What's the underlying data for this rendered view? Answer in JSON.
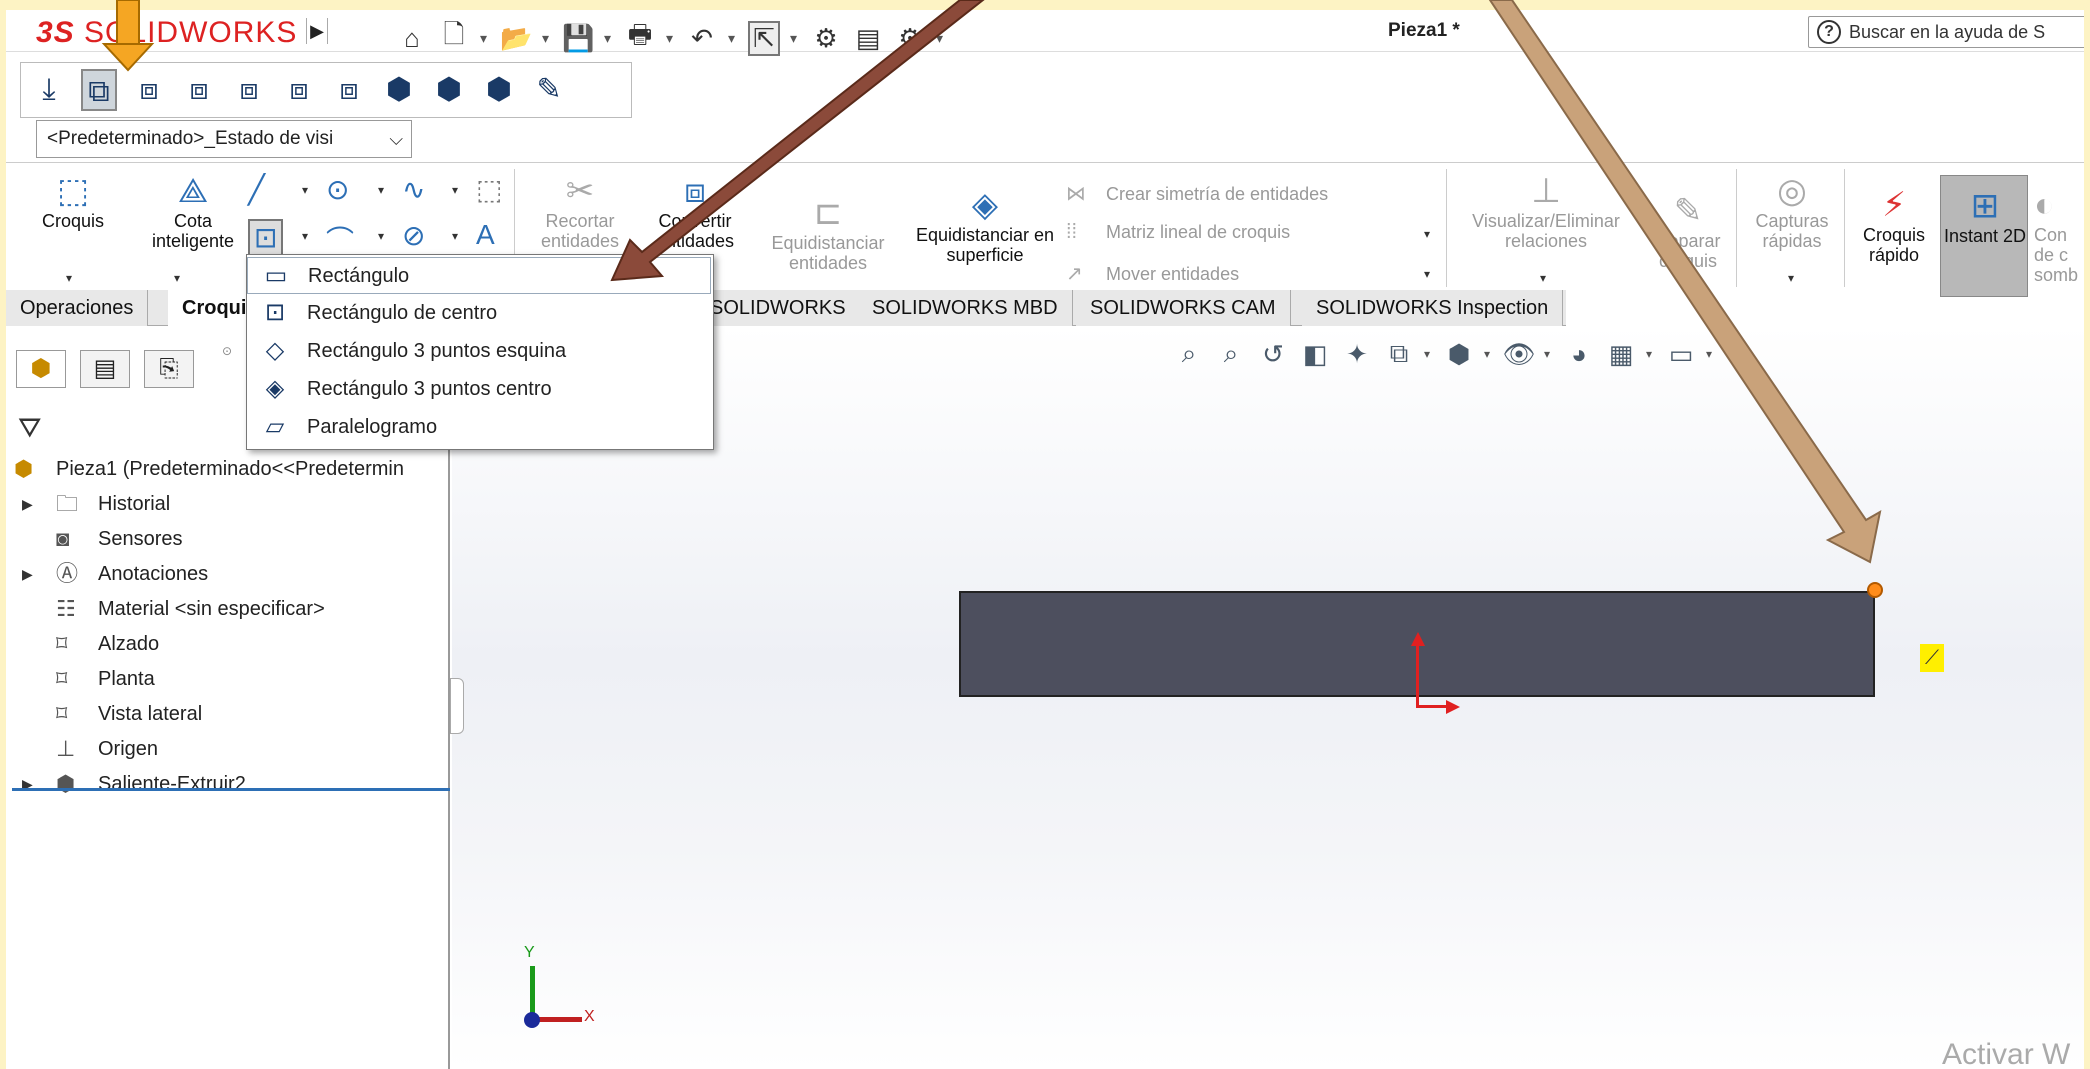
{
  "app": {
    "brand_prefix": "3S",
    "brand_suffix": "SOLIDWORKS",
    "doc_title": "Pieza1 *",
    "search_placeholder": "Buscar en la ayuda de S"
  },
  "config": {
    "selected": "<Predeterminado>_Estado de visi"
  },
  "commands": {
    "croquis": "Croquis",
    "cota": "Cota inteligente",
    "recortar": "Recortar entidades",
    "convertir": "Convertir entidades",
    "equidistanciar": "Equidistanciar entidades",
    "equid_superficie": "Equidistanciar en superficie",
    "simetria": "Crear simetría de entidades",
    "matriz": "Matriz lineal de croquis",
    "mover": "Mover entidades",
    "visualizar": "Visualizar/Eliminar relaciones",
    "reparar": "Reparar croquis",
    "capturas": "Capturas rápidas",
    "croquis_rapido": "Croquis rápido",
    "instant2d": "Instant 2D",
    "con": "Con de c somb"
  },
  "tabs": [
    "Operaciones",
    "Croquis",
    "SOLIDWORKS",
    "SOLIDWORKS MBD",
    "SOLIDWORKS CAM",
    "SOLIDWORKS Inspection"
  ],
  "rect_menu": [
    {
      "label": "Rectángulo",
      "icon": "rectangle-corner-icon"
    },
    {
      "label": "Rectángulo de centro",
      "icon": "rectangle-center-icon"
    },
    {
      "label": "Rectángulo 3 puntos esquina",
      "icon": "rectangle-3pt-corner-icon"
    },
    {
      "label": "Rectángulo 3 puntos centro",
      "icon": "rectangle-3pt-center-icon"
    },
    {
      "label": "Paralelogramo",
      "icon": "parallelogram-icon"
    }
  ],
  "tree": {
    "root": "Pieza1  (Predeterminado<<Predetermin",
    "items": [
      {
        "label": "Historial",
        "icon": "history-folder-icon"
      },
      {
        "label": "Sensores",
        "icon": "sensor-icon"
      },
      {
        "label": "Anotaciones",
        "icon": "annotations-icon"
      },
      {
        "label": "Material <sin especificar>",
        "icon": "material-icon"
      },
      {
        "label": "Alzado",
        "icon": "plane-icon"
      },
      {
        "label": "Planta",
        "icon": "plane-icon"
      },
      {
        "label": "Vista lateral",
        "icon": "plane-icon"
      },
      {
        "label": "Origen",
        "icon": "origin-icon"
      },
      {
        "label": "Saliente-Extruir2",
        "icon": "extrude-icon"
      }
    ]
  },
  "triad": {
    "x": "X",
    "y": "Y"
  },
  "watermark": "Activar W",
  "colors": {
    "accent": "#2d6fb5",
    "annotation_arrow": "#8b4a3a",
    "highlight": "#f5a623",
    "part_face": "#4d4f5e"
  }
}
